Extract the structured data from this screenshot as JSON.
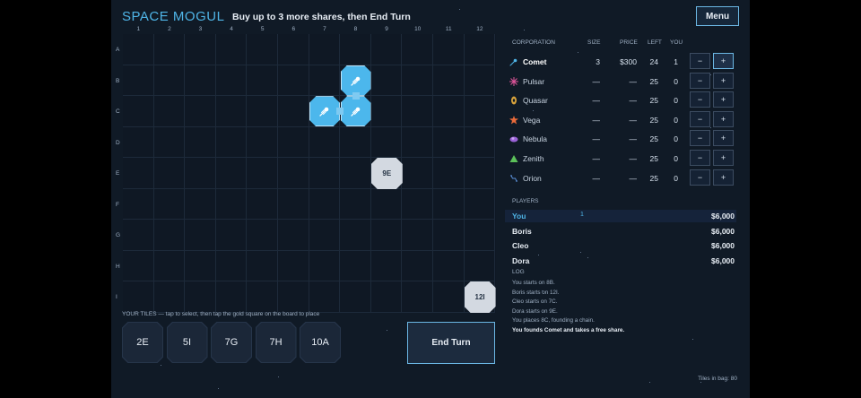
{
  "header": {
    "title": "SPACE MOGUL",
    "instruction": "Buy up to 3 more shares, then End Turn",
    "menu_label": "Menu"
  },
  "board": {
    "columns": [
      "1",
      "2",
      "3",
      "4",
      "5",
      "6",
      "7",
      "8",
      "9",
      "10",
      "11",
      "12"
    ],
    "rows": [
      "A",
      "B",
      "C",
      "D",
      "E",
      "F",
      "G",
      "H",
      "I"
    ],
    "placed": [
      {
        "id": "8B",
        "label": "",
        "corp": "Comet"
      },
      {
        "id": "7C",
        "label": "",
        "corp": "Comet"
      },
      {
        "id": "8C",
        "label": "",
        "corp": "Comet"
      },
      {
        "id": "9E",
        "label": "9E",
        "corp": null
      },
      {
        "id": "12I",
        "label": "12I",
        "corp": null
      }
    ]
  },
  "hand": {
    "label": "YOUR TILES — tap to select, then tap the gold square on the board to place",
    "tiles": [
      "2E",
      "5I",
      "7G",
      "7H",
      "10A"
    ],
    "end_turn_label": "End Turn"
  },
  "corporations": {
    "headers": {
      "name": "CORPORATION",
      "size": "SIZE",
      "price": "PRICE",
      "left": "LEFT",
      "you": "YOU"
    },
    "rows": [
      {
        "name": "Comet",
        "size": "3",
        "price": "$300",
        "left": "24",
        "you": "1",
        "color": "#4fb4e6",
        "icon": "comet-icon",
        "active": true
      },
      {
        "name": "Pulsar",
        "size": "—",
        "price": "—",
        "left": "25",
        "you": "0",
        "color": "#e0559a",
        "icon": "pulsar-icon",
        "active": false
      },
      {
        "name": "Quasar",
        "size": "—",
        "price": "—",
        "left": "25",
        "you": "0",
        "color": "#d9a33c",
        "icon": "quasar-icon",
        "active": false
      },
      {
        "name": "Vega",
        "size": "—",
        "price": "—",
        "left": "25",
        "you": "0",
        "color": "#e86a3a",
        "icon": "vega-icon",
        "active": false
      },
      {
        "name": "Nebula",
        "size": "—",
        "price": "—",
        "left": "25",
        "you": "0",
        "color": "#9a62d6",
        "icon": "nebula-icon",
        "active": false
      },
      {
        "name": "Zenith",
        "size": "—",
        "price": "—",
        "left": "25",
        "you": "0",
        "color": "#5cc15a",
        "icon": "zenith-icon",
        "active": false
      },
      {
        "name": "Orion",
        "size": "—",
        "price": "—",
        "left": "25",
        "you": "0",
        "color": "#5a8fd6",
        "icon": "orion-icon",
        "active": false
      }
    ],
    "minus": "−",
    "plus": "+"
  },
  "players": {
    "label": "PLAYERS",
    "rows": [
      {
        "name": "You",
        "shares": "1",
        "cash": "$6,000",
        "current": true
      },
      {
        "name": "Boris",
        "shares": "",
        "cash": "$6,000",
        "current": false
      },
      {
        "name": "Cleo",
        "shares": "",
        "cash": "$6,000",
        "current": false
      },
      {
        "name": "Dora",
        "shares": "",
        "cash": "$6,000",
        "current": false
      }
    ]
  },
  "log": {
    "label": "LOG",
    "lines": [
      {
        "text": "You starts on 8B.",
        "highlight": false
      },
      {
        "text": "Boris starts on 12I.",
        "highlight": false
      },
      {
        "text": "Cleo starts on 7C.",
        "highlight": false
      },
      {
        "text": "Dora starts on 9E.",
        "highlight": false
      },
      {
        "text": "You places 8C, founding a chain.",
        "highlight": false
      },
      {
        "text": "You founds Comet and takes a free share.",
        "highlight": true
      }
    ]
  },
  "footer": {
    "tiles_in_bag": "Tiles in bag: 80"
  }
}
